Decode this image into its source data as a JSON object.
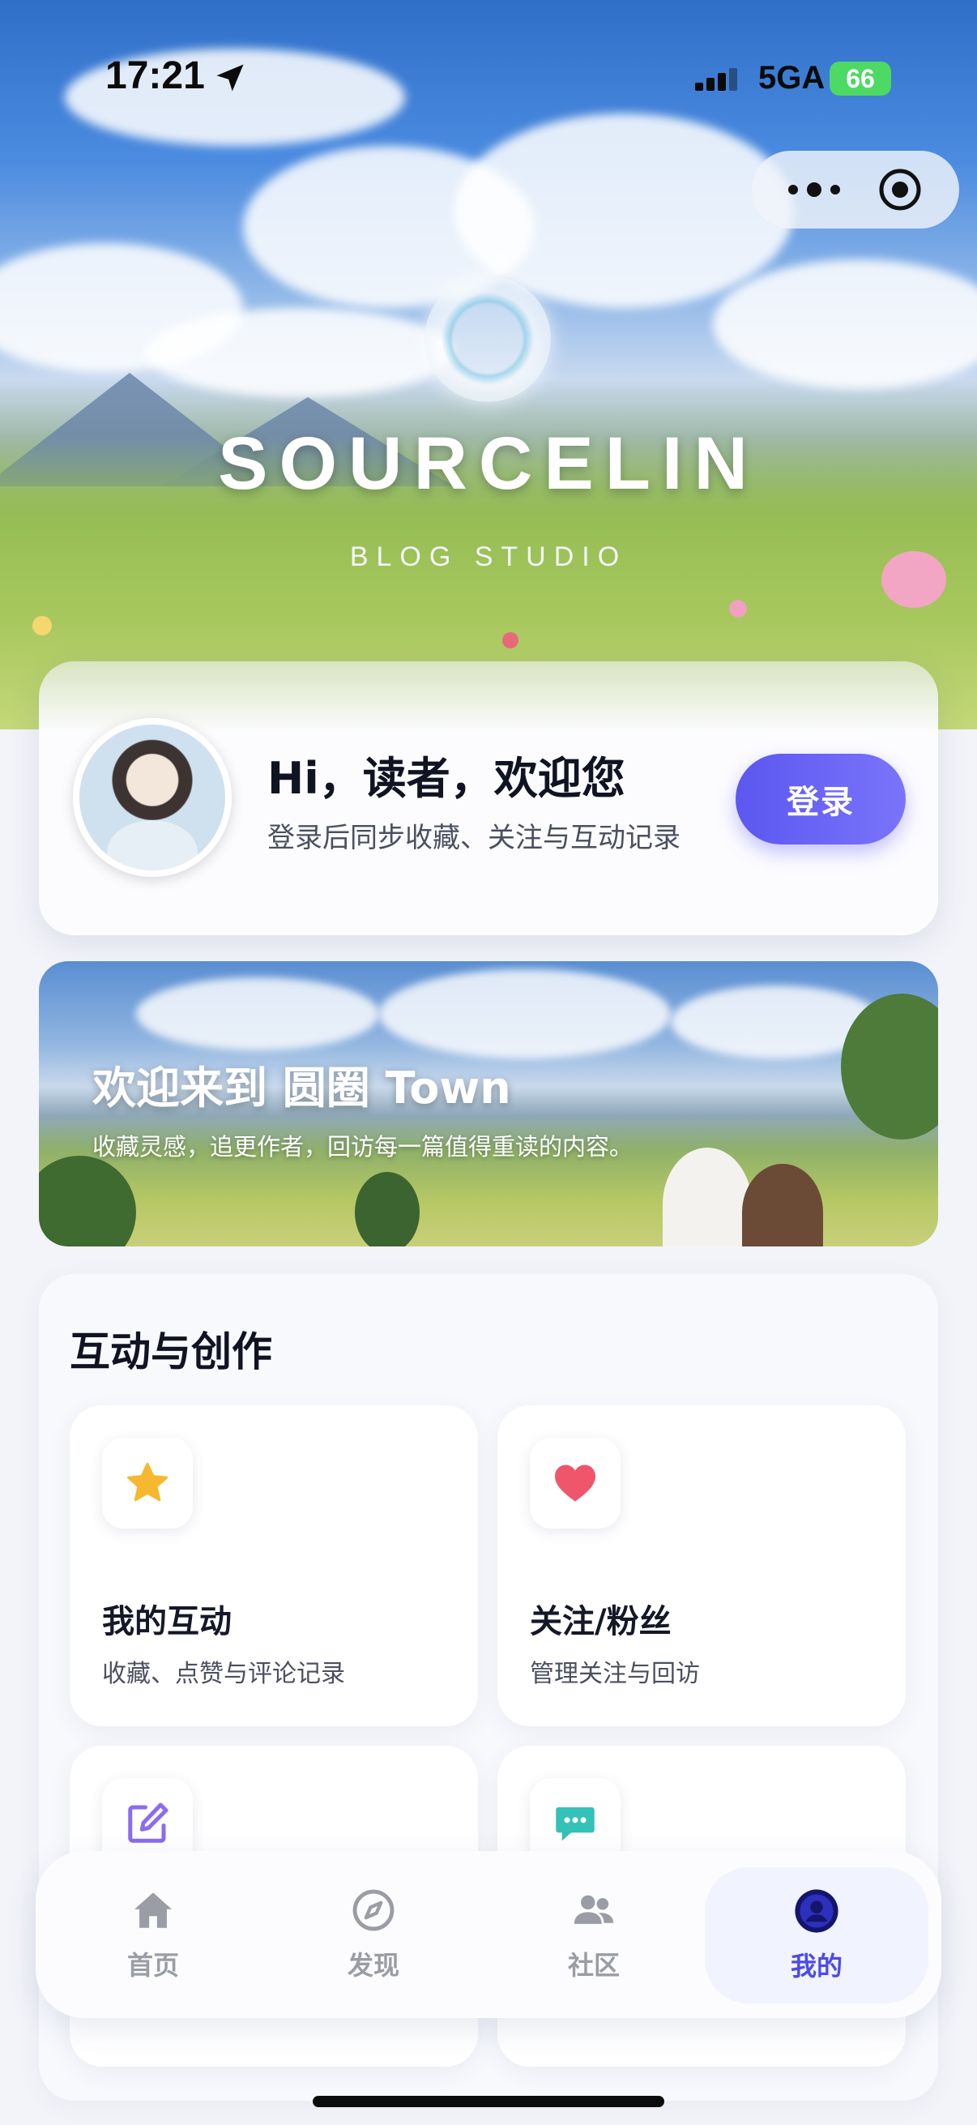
{
  "status_bar": {
    "time": "17:21",
    "network": "5GA",
    "battery": "66"
  },
  "capsule": {
    "more_icon": "more-dots-icon",
    "close_icon": "target-circle-icon"
  },
  "brand": {
    "title": "SOURCELIN",
    "subtitle": "BLOG STUDIO"
  },
  "profile": {
    "greeting": "Hi，读者，欢迎您",
    "subtitle": "登录后同步收藏、关注与互动记录",
    "login_label": "登录"
  },
  "banner": {
    "title": "欢迎来到 圆圈 Town",
    "subtitle": "收藏灵感，追更作者，回访每一篇值得重读的内容。"
  },
  "section": {
    "title": "互动与创作",
    "tiles": [
      {
        "icon": "star-icon",
        "title": "我的互动",
        "desc": "收藏、点赞与评论记录",
        "color": "#f5b82e"
      },
      {
        "icon": "heart-icon",
        "title": "关注/粉丝",
        "desc": "管理关注与回访",
        "color": "#f0566b"
      },
      {
        "icon": "edit-icon",
        "title": "",
        "desc": "",
        "color": "#8b6cf0"
      },
      {
        "icon": "chat-icon",
        "title": "",
        "desc": "",
        "color": "#34c1b8"
      }
    ]
  },
  "tabbar": {
    "tabs": [
      {
        "label": "首页",
        "icon": "home-icon",
        "active": false
      },
      {
        "label": "发现",
        "icon": "compass-icon",
        "active": false
      },
      {
        "label": "社区",
        "icon": "community-icon",
        "active": false
      },
      {
        "label": "我的",
        "icon": "profile-icon",
        "active": true
      }
    ]
  },
  "colors": {
    "accent": "#5b57f0",
    "tab_active": "#4d4ae8",
    "tab_inactive": "#9a9ca6",
    "background": "#f3f4f9"
  }
}
